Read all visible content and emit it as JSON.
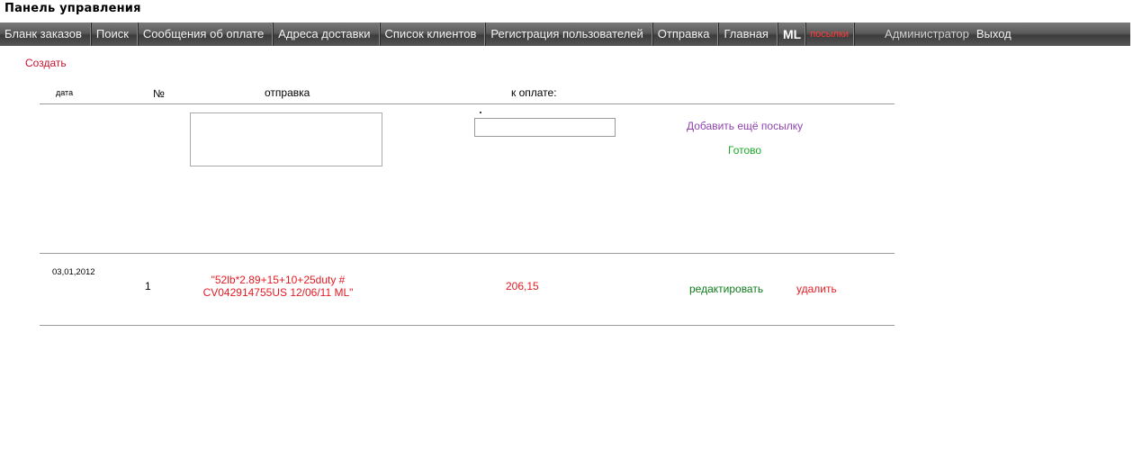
{
  "page": {
    "title": "Панель управления"
  },
  "nav": {
    "items": [
      "Бланк заказов",
      "Поиск",
      "Сообщения об оплате",
      "Адреса доставки",
      "Список клиентов",
      "Регистрация пользователей",
      "Отправка",
      "Главная"
    ],
    "ml": "ML",
    "parcels": "посылки",
    "admin": "Администратор",
    "exit": "Выход"
  },
  "create_label": "Создать",
  "table": {
    "headers": {
      "date": "дата",
      "number": "№",
      "shipment": "отправка",
      "payment": "к оплате:"
    },
    "form": {
      "shipment_value": "",
      "payment_value": "",
      "add_parcel_label": "Добавить ещё посылку",
      "done_label": "Готово"
    },
    "rows": [
      {
        "date": "03,01,2012",
        "number": "1",
        "shipment": "\"52lb*2.89+15+10+25duty # CV042914755US 12/06/11 ML\"",
        "payment": "206,15",
        "edit_label": "редактировать",
        "delete_label": "удалить"
      }
    ]
  },
  "colors": {
    "link_red": "#e31b23",
    "link_purple": "#8e44ad",
    "link_green": "#1aaa2a",
    "edit_green": "#0f7a1c"
  }
}
